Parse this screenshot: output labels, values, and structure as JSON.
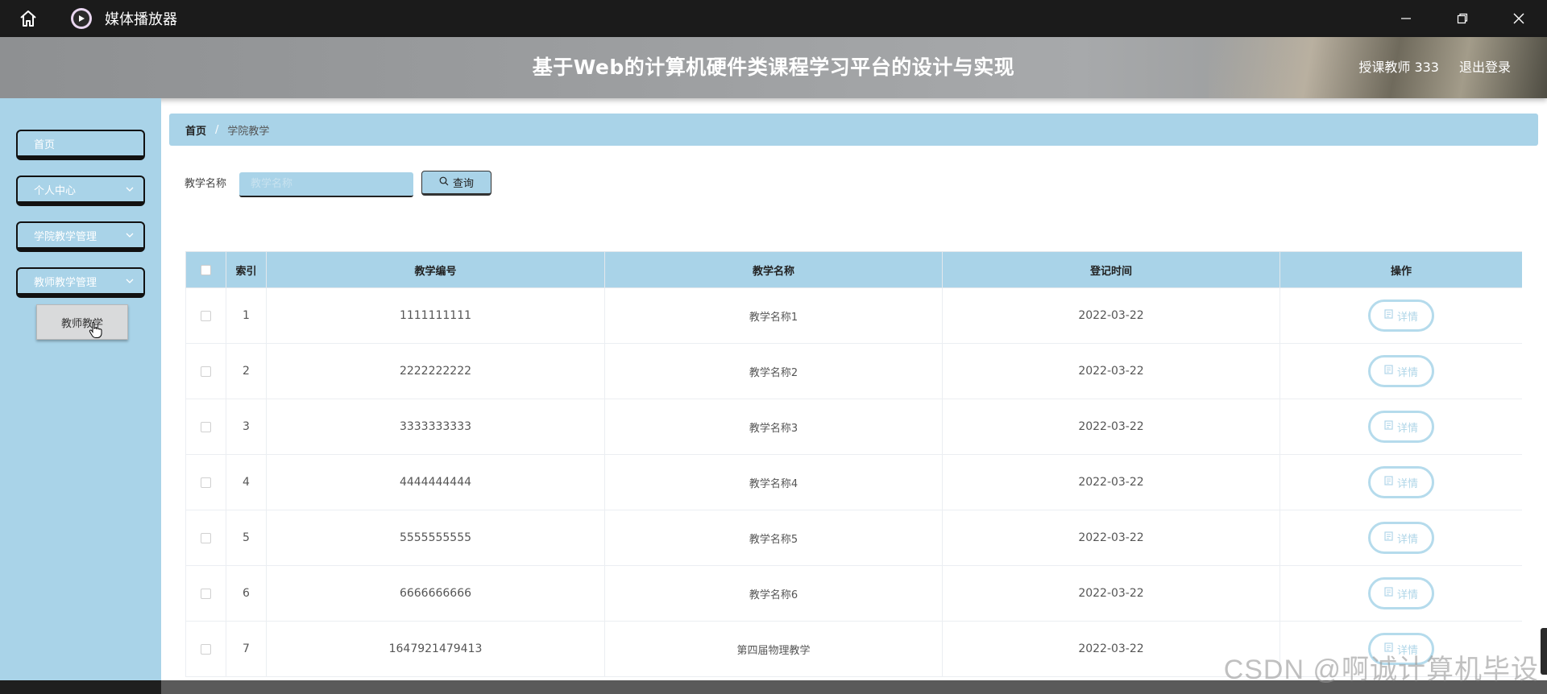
{
  "window": {
    "app_title": "媒体播放器"
  },
  "header": {
    "title": "基于Web的计算机硬件类课程学习平台的设计与实现",
    "user": "授课教师 333",
    "logout": "退出登录"
  },
  "sidebar": {
    "items": [
      {
        "label": "首页",
        "has_chevron": false
      },
      {
        "label": "个人中心",
        "has_chevron": true
      },
      {
        "label": "学院教学管理",
        "has_chevron": true
      },
      {
        "label": "教师教学管理",
        "has_chevron": true
      }
    ],
    "submenu": {
      "label": "教师教学"
    }
  },
  "breadcrumb": {
    "home": "首页",
    "separator": "/",
    "current": "学院教学"
  },
  "search": {
    "label": "教学名称",
    "placeholder": "教学名称",
    "button_label": "查询"
  },
  "table": {
    "headers": [
      "索引",
      "教学编号",
      "教学名称",
      "登记时间",
      "操作"
    ],
    "detail_label": "详情",
    "rows": [
      {
        "index": "1",
        "code": "1111111111",
        "name": "教学名称1",
        "date": "2022-03-22"
      },
      {
        "index": "2",
        "code": "2222222222",
        "name": "教学名称2",
        "date": "2022-03-22"
      },
      {
        "index": "3",
        "code": "3333333333",
        "name": "教学名称3",
        "date": "2022-03-22"
      },
      {
        "index": "4",
        "code": "4444444444",
        "name": "教学名称4",
        "date": "2022-03-22"
      },
      {
        "index": "5",
        "code": "5555555555",
        "name": "教学名称5",
        "date": "2022-03-22"
      },
      {
        "index": "6",
        "code": "6666666666",
        "name": "教学名称6",
        "date": "2022-03-22"
      },
      {
        "index": "7",
        "code": "1647921479413",
        "name": "第四届物理教学",
        "date": "2022-03-22"
      }
    ]
  },
  "watermark": "CSDN @啊诚计算机毕设",
  "colors": {
    "accent": "#a9d3e8",
    "titlebar": "#1b1b1b",
    "header": "#9c9ea0"
  }
}
